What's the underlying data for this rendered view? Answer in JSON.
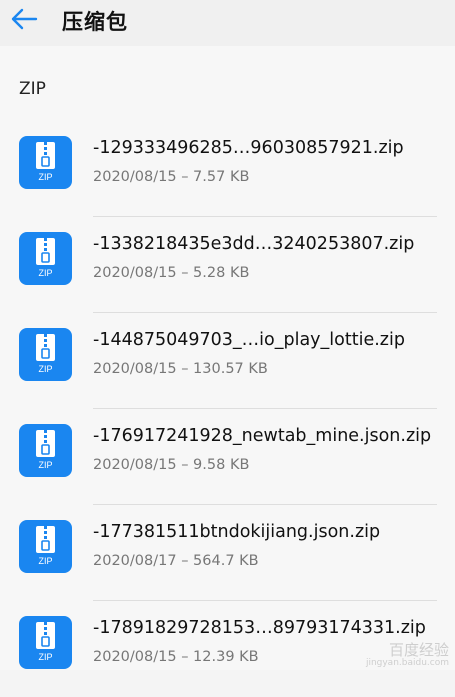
{
  "header": {
    "title": "压缩包"
  },
  "section": {
    "label": "ZIP"
  },
  "files": [
    {
      "name": "-129333496285…96030857921.zip",
      "date": "2020/08/15",
      "size": "7.57 KB"
    },
    {
      "name": "-1338218435e3dd…3240253807.zip",
      "date": "2020/08/15",
      "size": "5.28 KB"
    },
    {
      "name": "-144875049703_…io_play_lottie.zip",
      "date": "2020/08/15",
      "size": "130.57 KB"
    },
    {
      "name": "-176917241928_newtab_mine.json.zip",
      "date": "2020/08/15",
      "size": "9.58 KB"
    },
    {
      "name": "-177381511btndokijiang.json.zip",
      "date": "2020/08/17",
      "size": "564.7 KB"
    },
    {
      "name": "-17891829728153…89793174331.zip",
      "date": "2020/08/15",
      "size": "12.39 KB"
    }
  ],
  "icon_label": "ZIP",
  "meta_separator": "–",
  "watermark": {
    "text": "百度经验",
    "url": "jingyan.baidu.com"
  },
  "colors": {
    "accent": "#1a86f0",
    "back_arrow": "#1a86f0"
  }
}
